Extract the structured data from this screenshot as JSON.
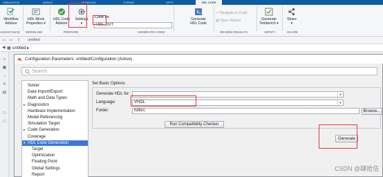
{
  "tabbar": {
    "tabs": [
      "SIMULATION",
      "DEBUG",
      "MODELING",
      "FORMAT",
      "APPS",
      "HDL CODE"
    ]
  },
  "ribbon": {
    "workflow_advisor": [
      "Workflow",
      "Advisor"
    ],
    "hdl_block_properties": [
      "HDL Block",
      "Properties ▾"
    ],
    "hdl_code_advisor": [
      "HDL Code",
      "Advisor"
    ],
    "settings": [
      "Settings",
      "▾"
    ],
    "code_for_label": "Code for",
    "code_for_value": "HDL_DUT",
    "generate_hdl_code": [
      "Generate",
      "HDL Code"
    ],
    "navigate_to_code": "Navigate to Code",
    "open_report": "Open Report",
    "generate_testbench": [
      "Generate",
      "Testbench ▾"
    ],
    "share": [
      "Share",
      "▾"
    ],
    "sections": {
      "assistance": "ASSISTANCE",
      "modeling": "MODELING",
      "prepare": "PREPARE",
      "generate_code": "GENERATE CODE",
      "review_results": "REVIEW RESULTS",
      "verify": "VERIFY",
      "share": "SHARE"
    }
  },
  "editor": {
    "model_tab": "untitled",
    "breadcrumb": "untitled ▸"
  },
  "dialog": {
    "title": "Configuration Parameters: untitled/Configuration (Active)",
    "search_placeholder": "Search",
    "tree": [
      {
        "label": "Solver",
        "indent": 0,
        "arrow": ""
      },
      {
        "label": "Data Import/Export",
        "indent": 0,
        "arrow": ""
      },
      {
        "label": "Math and Data Types",
        "indent": 0,
        "arrow": ""
      },
      {
        "label": "Diagnostics",
        "indent": 0,
        "arrow": "▸"
      },
      {
        "label": "Hardware Implementation",
        "indent": 0,
        "arrow": ""
      },
      {
        "label": "Model Referencing",
        "indent": 0,
        "arrow": ""
      },
      {
        "label": "Simulation Target",
        "indent": 0,
        "arrow": ""
      },
      {
        "label": "Code Generation",
        "indent": 0,
        "arrow": "▸"
      },
      {
        "label": "Coverage",
        "indent": 0,
        "arrow": ""
      },
      {
        "label": "HDL Code Generation",
        "indent": 0,
        "arrow": "▾",
        "selected": true
      },
      {
        "label": "Target",
        "indent": 1,
        "arrow": ""
      },
      {
        "label": "Optimization",
        "indent": 1,
        "arrow": ""
      },
      {
        "label": "Floating Point",
        "indent": 1,
        "arrow": ""
      },
      {
        "label": "Global Settings",
        "indent": 1,
        "arrow": ""
      },
      {
        "label": "Report",
        "indent": 1,
        "arrow": ""
      }
    ],
    "panel": {
      "title": "Set Basic Options",
      "generate_hdl_for_label": "Generate HDL for:",
      "generate_hdl_for_value": "",
      "language_label": "Language:",
      "language_value": "VHDL",
      "folder_label": "Folder:",
      "folder_value": "hdlsrc",
      "browse_button": "Browse...",
      "compat_button": "Run Compatibility Checker",
      "generate_button": "Generate"
    }
  },
  "watermark": "CSDN @肆拾伍",
  "colors": {
    "accent": "#0d5aa7",
    "selection": "#3b78d8",
    "highlight_box": "#e53935"
  }
}
